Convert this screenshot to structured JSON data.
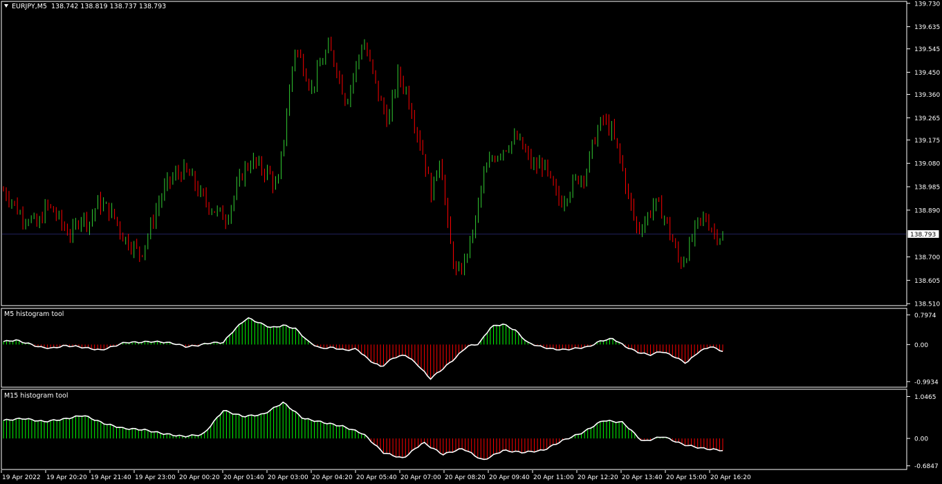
{
  "main_chart": {
    "symbol": "EURJPY,M5",
    "ohlc": "138.742 138.819 138.737 138.793",
    "price_scale": [
      "139.730",
      "139.635",
      "139.545",
      "139.450",
      "139.360",
      "139.265",
      "139.175",
      "139.080",
      "138.985",
      "138.890",
      "138.700",
      "138.605",
      "138.510"
    ],
    "current_price": "138.793",
    "price_range": [
      138.505,
      139.735
    ],
    "colors": {
      "bull": "#32cd32",
      "bear": "#ff0000",
      "background": "#000000",
      "current_line": "#20205a",
      "axis": "#ffffff"
    }
  },
  "m5_indicator": {
    "title": "M5 histogram tool",
    "scale": [
      "0.7974",
      "0.00",
      "-0.9934"
    ],
    "range": [
      -1.07,
      0.86
    ],
    "colors": {
      "positive": "#00ff00",
      "negative": "#ff0000",
      "line": "#ffffff"
    }
  },
  "m15_indicator": {
    "title": "M15 histogram tool",
    "scale": [
      "1.0465",
      "0.00",
      "-0.6847"
    ],
    "range": [
      -0.69,
      1.09
    ],
    "colors": {
      "positive": "#00ff00",
      "negative": "#ff0000",
      "line": "#ffffff"
    }
  },
  "time_axis": [
    "19 Apr 2022",
    "19 Apr 20:20",
    "19 Apr 21:40",
    "19 Apr 23:00",
    "20 Apr 00:20",
    "20 Apr 01:40",
    "20 Apr 03:00",
    "20 Apr 04:20",
    "20 Apr 05:40",
    "20 Apr 07:00",
    "20 Apr 08:20",
    "20 Apr 09:40",
    "20 Apr 11:00",
    "20 Apr 12:20",
    "20 Apr 13:40",
    "20 Apr 15:00",
    "20 Apr 16:20"
  ],
  "chart_data": [
    {
      "type": "candlestick",
      "title": "EURJPY,M5",
      "ylim": [
        138.51,
        139.73
      ],
      "close_series_approx": [
        138.97,
        138.93,
        138.87,
        138.86,
        138.82,
        138.91,
        138.88,
        138.82,
        138.79,
        138.87,
        138.84,
        138.92,
        138.9,
        138.86,
        138.78,
        138.75,
        138.71,
        138.8,
        138.91,
        138.99,
        139.03,
        139.05,
        139.02,
        138.95,
        138.91,
        138.88,
        138.86,
        138.95,
        139.05,
        139.09,
        139.06,
        139.04,
        138.97,
        139.26,
        139.55,
        139.48,
        139.38,
        139.48,
        139.55,
        139.46,
        139.33,
        139.45,
        139.58,
        139.46,
        139.33,
        139.25,
        139.44,
        139.38,
        139.25,
        139.12,
        138.95,
        139.12,
        138.78,
        138.61,
        138.7,
        138.82,
        139.02,
        139.1,
        139.13,
        139.16,
        139.18,
        139.12,
        139.06,
        139.08,
        138.99,
        138.92,
        138.97,
        139.02,
        139.04,
        139.18,
        139.26,
        139.21,
        139.1,
        138.94,
        138.81,
        138.85,
        138.92,
        138.88,
        138.78,
        138.67,
        138.73,
        138.83,
        138.86,
        138.8,
        138.78
      ]
    },
    {
      "type": "area",
      "title": "M5 histogram tool",
      "ylim": [
        -0.9934,
        0.7974
      ],
      "values_approx": [
        0.08,
        0.12,
        0.03,
        -0.07,
        -0.1,
        -0.03,
        -0.05,
        -0.1,
        -0.15,
        -0.05,
        0.06,
        0.06,
        0.08,
        0.07,
        0.03,
        -0.06,
        -0.02,
        0.05,
        0.05,
        0.42,
        0.72,
        0.58,
        0.45,
        0.52,
        0.42,
        0.08,
        -0.1,
        -0.08,
        -0.15,
        -0.12,
        -0.42,
        -0.6,
        -0.35,
        -0.28,
        -0.55,
        -0.92,
        -0.66,
        -0.38,
        -0.05,
        0.02,
        0.48,
        0.55,
        0.38,
        0.05,
        -0.05,
        -0.12,
        -0.14,
        -0.1,
        -0.06,
        0.1,
        0.16,
        -0.05,
        -0.2,
        -0.28,
        -0.18,
        -0.32,
        -0.5,
        -0.2,
        -0.05,
        -0.18
      ]
    },
    {
      "type": "area",
      "title": "M15 histogram tool",
      "ylim": [
        -0.6847,
        1.0465
      ],
      "values_approx": [
        0.45,
        0.5,
        0.42,
        0.48,
        0.58,
        0.38,
        0.25,
        0.22,
        0.12,
        0.05,
        0.1,
        0.7,
        0.55,
        0.6,
        0.9,
        0.5,
        0.4,
        0.3,
        0.12,
        -0.35,
        -0.5,
        -0.1,
        -0.4,
        -0.25,
        -0.55,
        -0.3,
        -0.35,
        -0.3,
        -0.05,
        0.15,
        0.45,
        0.4,
        -0.08,
        0.05,
        -0.15,
        -0.25,
        -0.3
      ]
    }
  ]
}
